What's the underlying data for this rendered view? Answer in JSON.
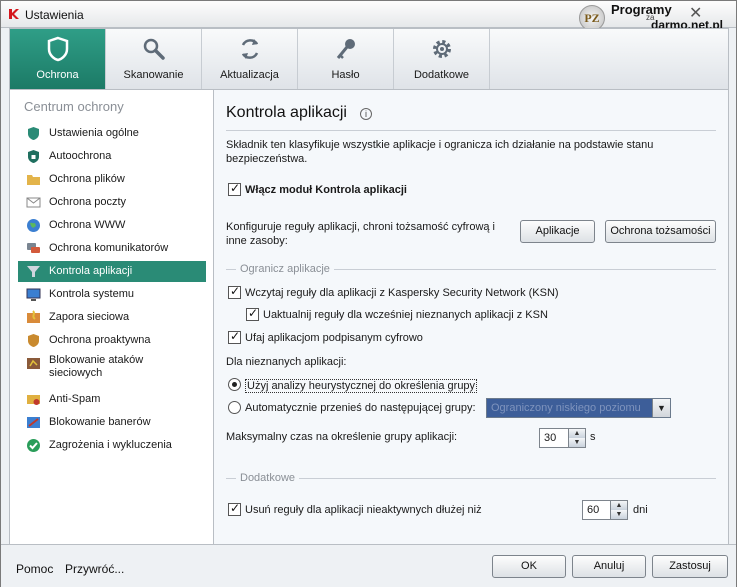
{
  "window": {
    "title": "Ustawienia"
  },
  "watermark": {
    "logo": "PZ",
    "line1": "Programy",
    "line2": "za",
    "line3": "darmo.net.pl"
  },
  "tabs": [
    {
      "label": "Ochrona",
      "icon": "shield-icon"
    },
    {
      "label": "Skanowanie",
      "icon": "magnifier-icon"
    },
    {
      "label": "Aktualizacja",
      "icon": "refresh-icon"
    },
    {
      "label": "Hasło",
      "icon": "key-icon"
    },
    {
      "label": "Dodatkowe",
      "icon": "gear-icon"
    }
  ],
  "sidebar": {
    "title": "Centrum ochrony",
    "items": [
      {
        "label": "Ustawienia ogólne",
        "icon": "shield-settings-icon"
      },
      {
        "label": "Autoochrona",
        "icon": "shield-lock-icon"
      },
      {
        "label": "Ochrona plików",
        "icon": "folder-icon"
      },
      {
        "label": "Ochrona poczty",
        "icon": "envelope-icon"
      },
      {
        "label": "Ochrona WWW",
        "icon": "globe-icon"
      },
      {
        "label": "Ochrona komunikatorów",
        "icon": "chat-icon"
      },
      {
        "label": "Kontrola aplikacji",
        "icon": "funnel-icon"
      },
      {
        "label": "Kontrola systemu",
        "icon": "monitor-icon"
      },
      {
        "label": "Zapora sieciowa",
        "icon": "firewall-icon"
      },
      {
        "label": "Ochrona proaktywna",
        "icon": "proactive-shield-icon"
      },
      {
        "label": "Blokowanie ataków sieciowych",
        "icon": "network-block-icon"
      },
      {
        "label": "Anti-Spam",
        "icon": "antispam-icon"
      },
      {
        "label": "Blokowanie banerów",
        "icon": "banner-block-icon"
      },
      {
        "label": "Zagrożenia i wykluczenia",
        "icon": "check-circle-icon"
      }
    ],
    "active_index": 6
  },
  "main": {
    "title": "Kontrola aplikacji",
    "description": "Składnik ten klasyfikuje wszystkie aplikacje i ogranicza ich działanie na podstawie stanu bezpieczeństwa.",
    "enable_module": "Włącz moduł Kontrola aplikacji",
    "configure_text": "Konfiguruje reguły aplikacji, chroni tożsamość cyfrową i inne zasoby:",
    "btn_apps": "Aplikacje",
    "btn_identity": "Ochrona tożsamości",
    "section_limit": "Ogranicz aplikacje",
    "load_ksn": "Wczytaj reguły dla aplikacji z Kaspersky Security Network (KSN)",
    "update_rules": "Uaktualnij reguły dla wcześniej nieznanych aplikacji z KSN",
    "trust_signed": "Ufaj aplikacjom podpisanym cyfrowo",
    "unknown_apps": "Dla nieznanych aplikacji:",
    "radio_heuristic": "Użyj analizy heurystycznej do określenia grupy",
    "radio_move": "Automatycznie przenieś do następującej grupy:",
    "group_value": "Ograniczony niskiego poziomu",
    "max_time_label": "Maksymalny czas na określenie grupy aplikacji:",
    "max_time_value": "30",
    "max_time_unit": "s",
    "section_extra": "Dodatkowe",
    "remove_rules": "Usuń reguły dla aplikacji nieaktywnych dłużej niż",
    "days_value": "60",
    "days_unit": "dni"
  },
  "footer": {
    "help": "Pomoc",
    "restore": "Przywróć...",
    "ok": "OK",
    "cancel": "Anuluj",
    "apply": "Zastosuj"
  }
}
